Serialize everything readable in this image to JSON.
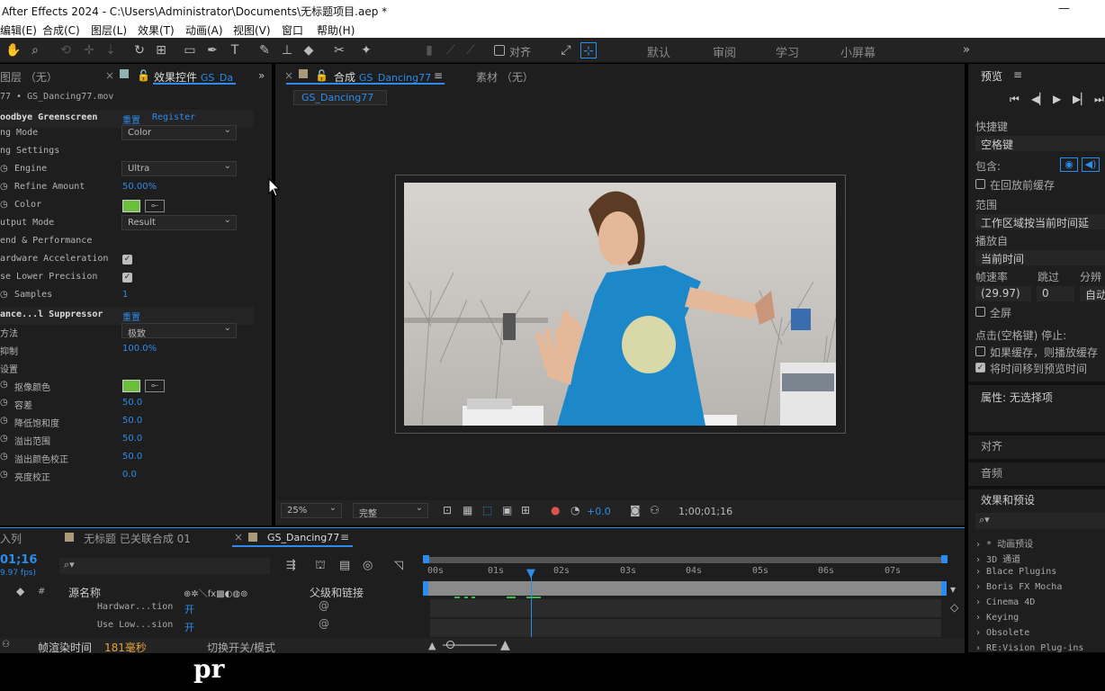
{
  "window": {
    "title": "After Effects 2024 - C:\\Users\\Administrator\\Documents\\无标题项目.aep *",
    "minimize_icon": "minimize-icon",
    "close_icon": "close-icon"
  },
  "menu": [
    "编辑(E)",
    "合成(C)",
    "图层(L)",
    "效果(T)",
    "动画(A)",
    "视图(V)",
    "窗口",
    "帮助(H)"
  ],
  "toolbar": {
    "align_label": "对齐",
    "workspaces": [
      "默认",
      "审阅",
      "学习",
      "小屏幕"
    ],
    "more": "»"
  },
  "left_panel": {
    "layer_tab": "图层 （无）",
    "effects_tab": "效果控件",
    "effects_tab_target": "GS_Da",
    "source": "77 • GS_Dancing77.mov",
    "effect1": {
      "name": "oodbye Greenscreen",
      "reset": "重置",
      "register": "Register"
    },
    "rows": [
      {
        "label": "ng Mode",
        "dropdown": "Color"
      },
      {
        "label": "ng Settings"
      },
      {
        "label": "Engine",
        "dropdown": "Ultra"
      },
      {
        "label": "Refine Amount",
        "value": "50.00%"
      },
      {
        "label": "Color"
      },
      {
        "label": "utput Mode",
        "dropdown": "Result"
      },
      {
        "label": "end & Performance"
      },
      {
        "label": "ardware Acceleration"
      },
      {
        "label": "se Lower Precision"
      },
      {
        "label": "Samples",
        "value": "1"
      }
    ],
    "effect2": {
      "name": "ance...l Suppressor",
      "reset": "重置"
    },
    "rows2": [
      {
        "label": "方法",
        "dropdown": "极致"
      },
      {
        "label": "抑制",
        "value": "100.0%"
      },
      {
        "label": "设置"
      },
      {
        "label": "抠像颜色"
      },
      {
        "label": "容差",
        "value": "50.0"
      },
      {
        "label": "降低饱和度",
        "value": "50.0"
      },
      {
        "label": "溢出范围",
        "value": "50.0"
      },
      {
        "label": "溢出颜色校正",
        "value": "50.0"
      },
      {
        "label": "亮度校正",
        "value": "0.0"
      }
    ]
  },
  "comp_panel": {
    "tab_label": "合成",
    "tab_target": "GS_Dancing77",
    "footage_tab": "素材 （无）",
    "subtab": "GS_Dancing77",
    "zoom": "25%",
    "quality": "完整",
    "exposure": "+0.0",
    "timecode": "1;00;01;16"
  },
  "right_panel": {
    "preview_title": "预览",
    "shortcut_label": "快捷键",
    "shortcut_value": "空格键",
    "include_label": "包含:",
    "cache_before": "在回放前缓存",
    "range_label": "范围",
    "range_value": "工作区域按当前时间延",
    "play_from_label": "播放自",
    "play_from_value": "当前时间",
    "fps_label": "帧速率",
    "skip_label": "跳过",
    "res_label": "分辨",
    "fps_value": "(29.97)",
    "skip_value": "0",
    "res_value": "自动",
    "fullscreen": "全屏",
    "stop_label": "点击(空格键) 停止:",
    "if_cached": "如果缓存，则播放缓存",
    "move_time": "将时间移到预览时间",
    "properties": "属性: 无选择项",
    "align": "对齐",
    "audio": "音频",
    "effects_presets": "效果和预设",
    "fx_list": [
      "* 动画预设",
      "3D 通道",
      "Blace Plugins",
      "Boris FX Mocha",
      "Cinema 4D",
      "Keying",
      "Obsolete",
      "RE:Vision Plug-ins"
    ]
  },
  "timeline": {
    "queue_tab": "入列",
    "tab1": "无标题 已关联合成 01",
    "tab2": "GS_Dancing77",
    "current_time": "01;16",
    "fps": "9.97 fps)",
    "col_source": "源名称",
    "col_parent": "父级和链接",
    "col_hash": "#",
    "layers": [
      {
        "name": "Hardwar...tion",
        "value": "开"
      },
      {
        "name": "Use Low...sion",
        "value": "开"
      }
    ],
    "ticks": [
      "00s",
      "01s",
      "02s",
      "03s",
      "04s",
      "05s",
      "06s",
      "07s"
    ],
    "render_time_label": "帧渲染时间",
    "render_time_value": "181毫秒",
    "toggle_label": "切换开关/模式"
  },
  "watermark": "pr",
  "colors": {
    "accent": "#2d8ceb",
    "panel": "#1e1e1e",
    "key_color": "#6cbf3c"
  }
}
